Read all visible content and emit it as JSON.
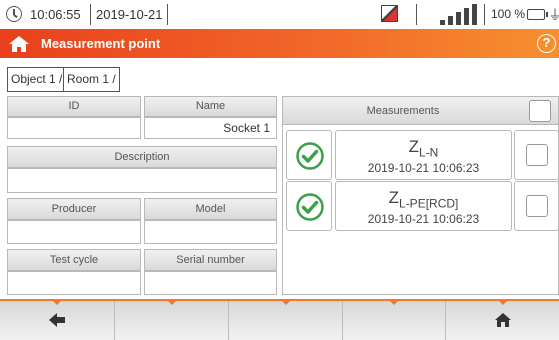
{
  "status_bar": {
    "time": "10:06:55",
    "date": "2019-10-21",
    "battery_percent": "100 %",
    "signal_level": 4,
    "icons": [
      "clock-icon",
      "memory-card-icon",
      "signal-icon",
      "battery-icon",
      "plug-icon"
    ]
  },
  "title_bar": {
    "title": "Measurement point",
    "icons": [
      "home-icon",
      "help-icon"
    ],
    "accent_color": "#f26a2a"
  },
  "breadcrumb": [
    "Object 1 /",
    "Room 1 /"
  ],
  "form": {
    "id_label": "ID",
    "id_value": "",
    "name_label": "Name",
    "name_value": "Socket 1",
    "description_label": "Description",
    "description_value": "",
    "producer_label": "Producer",
    "producer_value": "",
    "model_label": "Model",
    "model_value": "",
    "test_cycle_label": "Test cycle",
    "test_cycle_value": "",
    "serial_label": "Serial number",
    "serial_value": ""
  },
  "measurements": {
    "header": "Measurements",
    "rows": [
      {
        "symbol": "Z",
        "sub": "L-N",
        "timestamp": "2019-10-21 10:06:23",
        "status": "ok"
      },
      {
        "symbol": "Z",
        "sub": "L-PE[RCD]",
        "timestamp": "2019-10-21 10:06:23",
        "status": "ok"
      }
    ],
    "ok_color": "#3aa04a"
  },
  "toolbar": {
    "buttons": [
      "back-arrow-icon",
      "",
      "",
      "",
      "home-icon"
    ]
  }
}
